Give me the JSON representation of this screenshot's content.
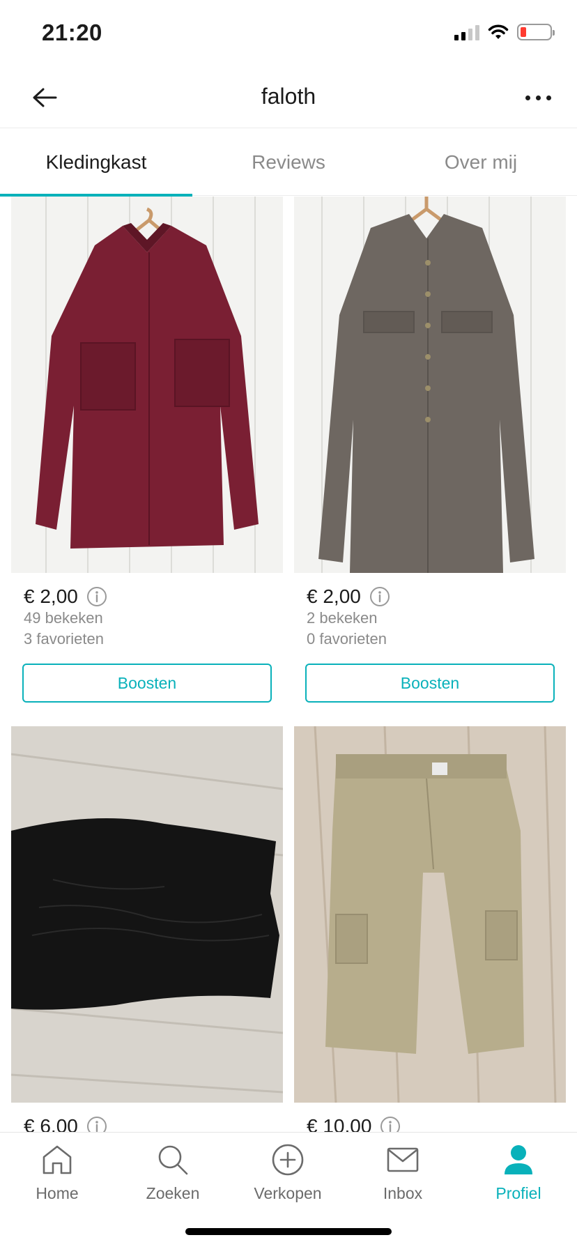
{
  "status_bar": {
    "time": "21:20",
    "icons": [
      "cellular-signal-icon",
      "wifi-icon",
      "battery-low-icon"
    ],
    "battery_color": "#ff3b30"
  },
  "header": {
    "title": "faloth",
    "back_icon": "arrow-left-icon",
    "more_icon": "more-horizontal-icon"
  },
  "tabs": [
    {
      "label": "Kledingkast",
      "active": true
    },
    {
      "label": "Reviews",
      "active": false
    },
    {
      "label": "Over mij",
      "active": false
    }
  ],
  "items": [
    {
      "price": "€ 2,00",
      "views": "49 bekeken",
      "favorites": "3 favorieten",
      "button": "Boosten",
      "image": "burgundy-sheer-blouse-photo",
      "color": "#7a1f33"
    },
    {
      "price": "€ 2,00",
      "views": "2 bekeken",
      "favorites": "0 favorieten",
      "button": "Boosten",
      "image": "grey-utility-shirt-dress-photo",
      "color": "#6e6761"
    },
    {
      "price": "€ 6,00",
      "image": "black-ruched-dress-photo",
      "color": "#141414"
    },
    {
      "price": "€ 10,00",
      "image": "khaki-cargo-capri-pants-photo",
      "color": "#b7ad8c"
    }
  ],
  "bottom_nav": [
    {
      "label": "Home",
      "icon": "home-icon",
      "active": false
    },
    {
      "label": "Zoeken",
      "icon": "search-icon",
      "active": false
    },
    {
      "label": "Verkopen",
      "icon": "plus-circle-icon",
      "active": false
    },
    {
      "label": "Inbox",
      "icon": "mail-icon",
      "active": false
    },
    {
      "label": "Profiel",
      "icon": "profile-icon",
      "active": true
    }
  ],
  "accent_color": "#09b1ba"
}
